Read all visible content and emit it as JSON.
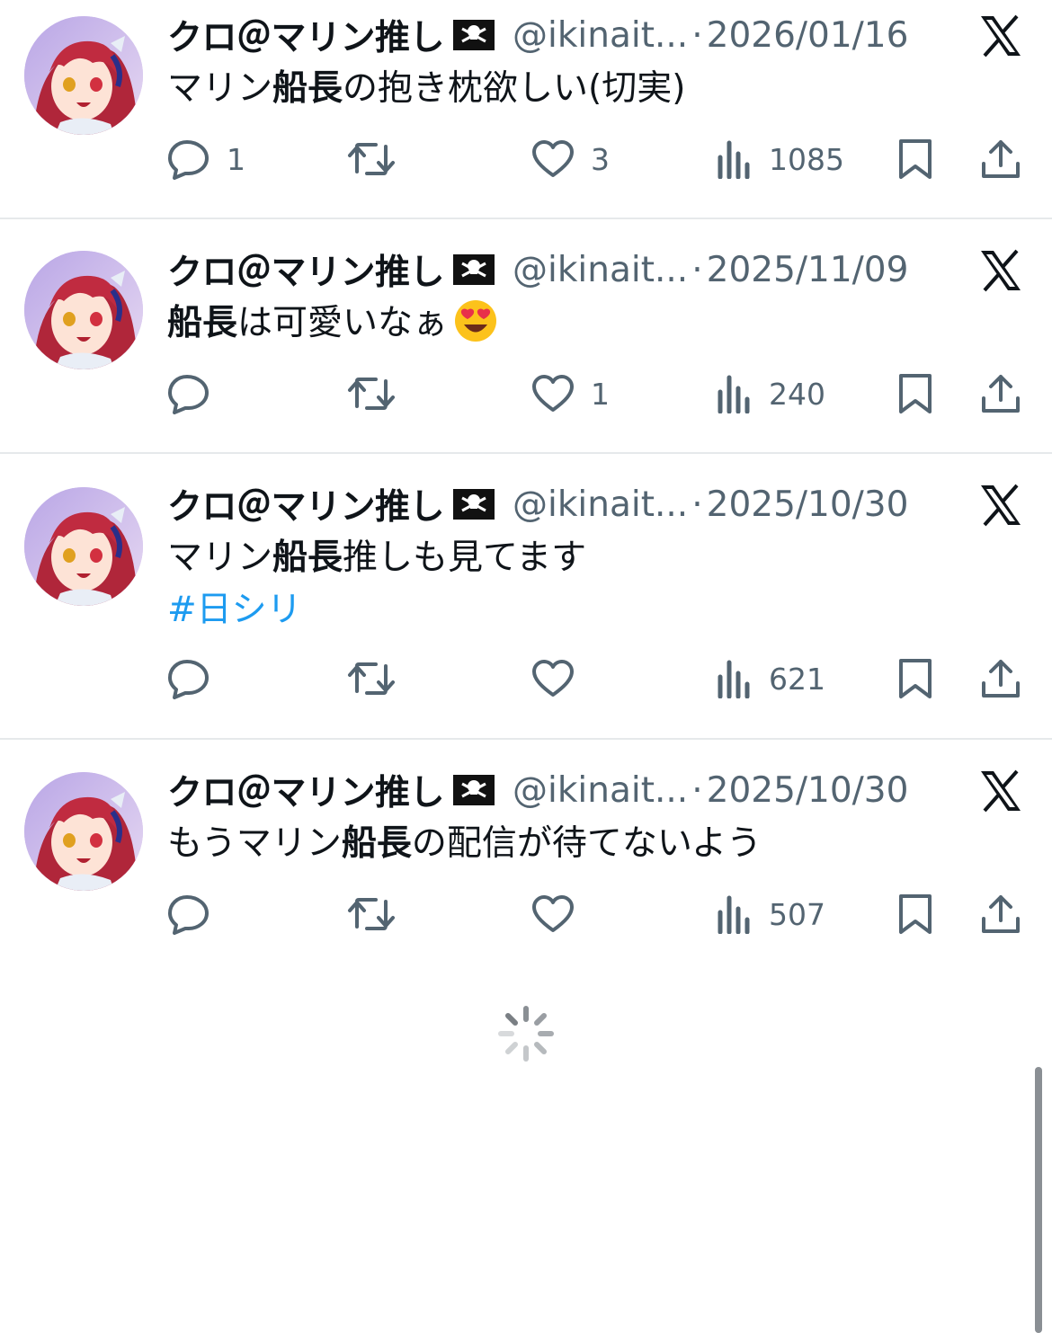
{
  "tweets": [
    {
      "author_name": "クロ＠マリン推し",
      "handle": "@ikinait...",
      "separator": "·",
      "date": "2026/01/16",
      "text_pre": "マリン",
      "text_bold": "船長",
      "text_post": "の抱き枕欲しい(切実)",
      "hashtag": "",
      "emoji": "",
      "reply_count": "1",
      "retweet_count": "",
      "like_count": "3",
      "view_count": "1085"
    },
    {
      "author_name": "クロ＠マリン推し",
      "handle": "@ikinait...",
      "separator": "·",
      "date": "2025/11/09",
      "text_pre": "",
      "text_bold": "船長",
      "text_post": "は可愛いなぁ",
      "hashtag": "",
      "emoji": "heart-eyes-emoji",
      "reply_count": "",
      "retweet_count": "",
      "like_count": "1",
      "view_count": "240"
    },
    {
      "author_name": "クロ＠マリン推し",
      "handle": "@ikinait...",
      "separator": "·",
      "date": "2025/10/30",
      "text_pre": "マリン",
      "text_bold": "船長",
      "text_post": "推しも見てます",
      "hashtag": "#日シリ",
      "emoji": "",
      "reply_count": "",
      "retweet_count": "",
      "like_count": "",
      "view_count": "621"
    },
    {
      "author_name": "クロ＠マリン推し",
      "handle": "@ikinait...",
      "separator": "·",
      "date": "2025/10/30",
      "text_pre": "もうマリン",
      "text_bold": "船長",
      "text_post": "の配信が待てないよう",
      "hashtag": "",
      "emoji": "",
      "reply_count": "",
      "retweet_count": "",
      "like_count": "",
      "view_count": "507"
    }
  ],
  "icons": {
    "platform_logo": "x-logo-icon",
    "name_flag": "pirate-flag-icon",
    "reply": "reply-icon",
    "retweet": "retweet-icon",
    "like": "heart-icon",
    "views": "views-chart-icon",
    "bookmark": "bookmark-icon",
    "share": "share-icon",
    "loading": "loading-spinner-icon"
  },
  "colors": {
    "text_primary": "#0f1419",
    "text_secondary": "#536471",
    "hashtag": "#1d9bf0",
    "divider": "#e6e9eb"
  }
}
